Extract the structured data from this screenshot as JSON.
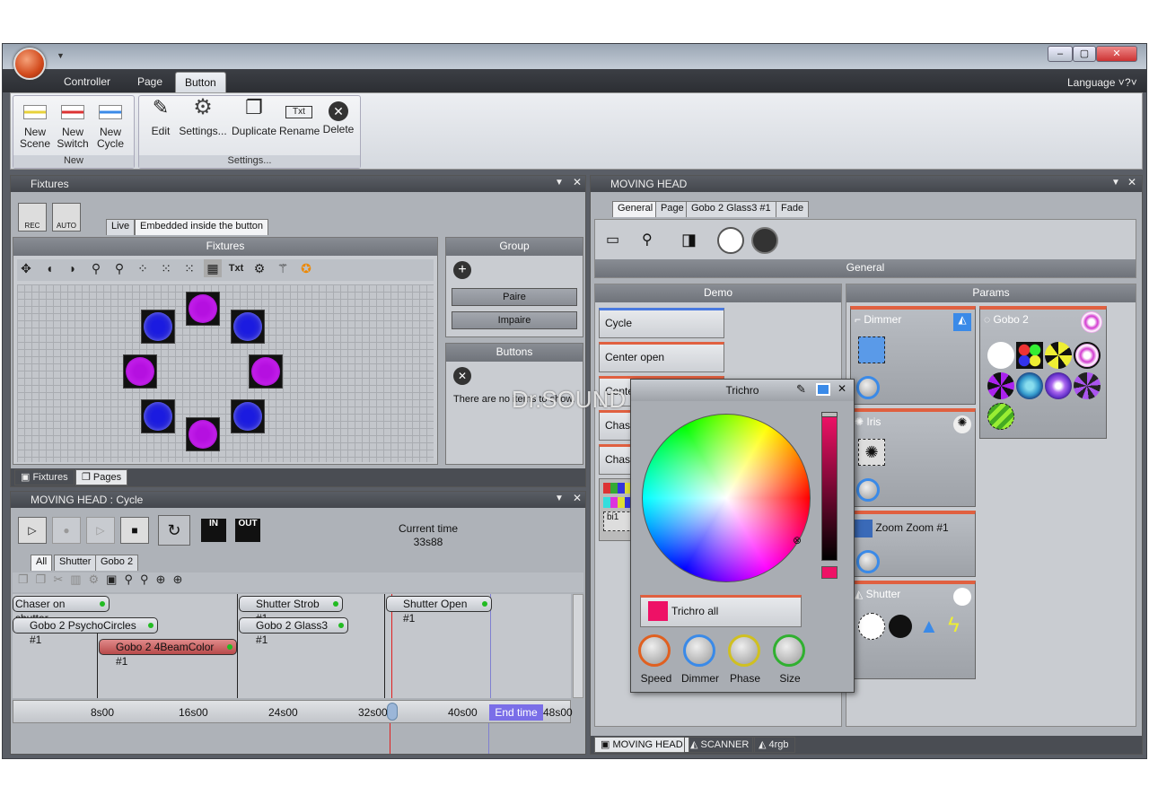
{
  "window": {
    "minimize": "‒",
    "maximize": "▢",
    "close": "✕"
  },
  "ribbon": {
    "tabs": [
      "Controller",
      "Page",
      "Button"
    ],
    "language": "Language",
    "help": "?",
    "groups": {
      "new": "New",
      "settings": "Settings..."
    },
    "buttons": {
      "new_scene": "New\nScene",
      "new_switch": "New\nSwitch",
      "new_cycle": "New\nCycle",
      "edit": "Edit",
      "settings": "Settings...",
      "duplicate": "Duplicate",
      "rename": "Rename",
      "delete": "Delete"
    }
  },
  "fixtures_panel": {
    "title": "Fixtures",
    "rec": "REC",
    "auto": "AUTO",
    "tabs": [
      "Live",
      "Embedded inside the button"
    ],
    "fixtures_title": "Fixtures",
    "group_title": "Group",
    "group_buttons": [
      "Paire",
      "Impaire"
    ],
    "buttons_title": "Buttons",
    "buttons_empty": "There are no items to show.",
    "bottom_tabs": [
      "Fixtures",
      "Pages"
    ],
    "toolbar_txt": "Txt"
  },
  "cycle_panel": {
    "title": "MOVING HEAD : Cycle",
    "in": "IN",
    "out": "OUT",
    "current_time_label": "Current time",
    "current_time": "33s88",
    "tabs": [
      "All",
      "Shutter",
      "Gobo 2"
    ],
    "tracks": [
      "Chaser on shutter",
      "Gobo 2 PsychoCircles #1",
      "Gobo 2 4BeamColor #1",
      "Shutter Strob #1",
      "Gobo 2 Glass3 #1",
      "Shutter Open #1"
    ],
    "ruler": [
      "8s00",
      "16s00",
      "24s00",
      "32s00",
      "40s00",
      "48s00"
    ],
    "end_time": "End time"
  },
  "moving_head": {
    "title": "MOVING HEAD",
    "tabs": [
      "General",
      "Page",
      "Gobo 2 Glass3 #1",
      "Fade"
    ],
    "general_title": "General",
    "demo_title": "Demo",
    "params_title": "Params",
    "demo_buttons": [
      "Cycle",
      "Center open",
      "Center",
      "Chase",
      "Chase"
    ],
    "demo_mini": "bi1",
    "params": [
      "Dimmer",
      "Gobo 2",
      "Iris",
      "Zoom Zoom #1",
      "Shutter"
    ],
    "status_tabs": [
      "MOVING HEAD",
      "SCANNER",
      "4rgb"
    ]
  },
  "trichro": {
    "title": "Trichro",
    "all_label": "Trichro all",
    "knobs": [
      "Speed",
      "Dimmer",
      "Phase",
      "Size"
    ],
    "color": "#ee1166"
  },
  "watermark": "Dr.SOUND"
}
